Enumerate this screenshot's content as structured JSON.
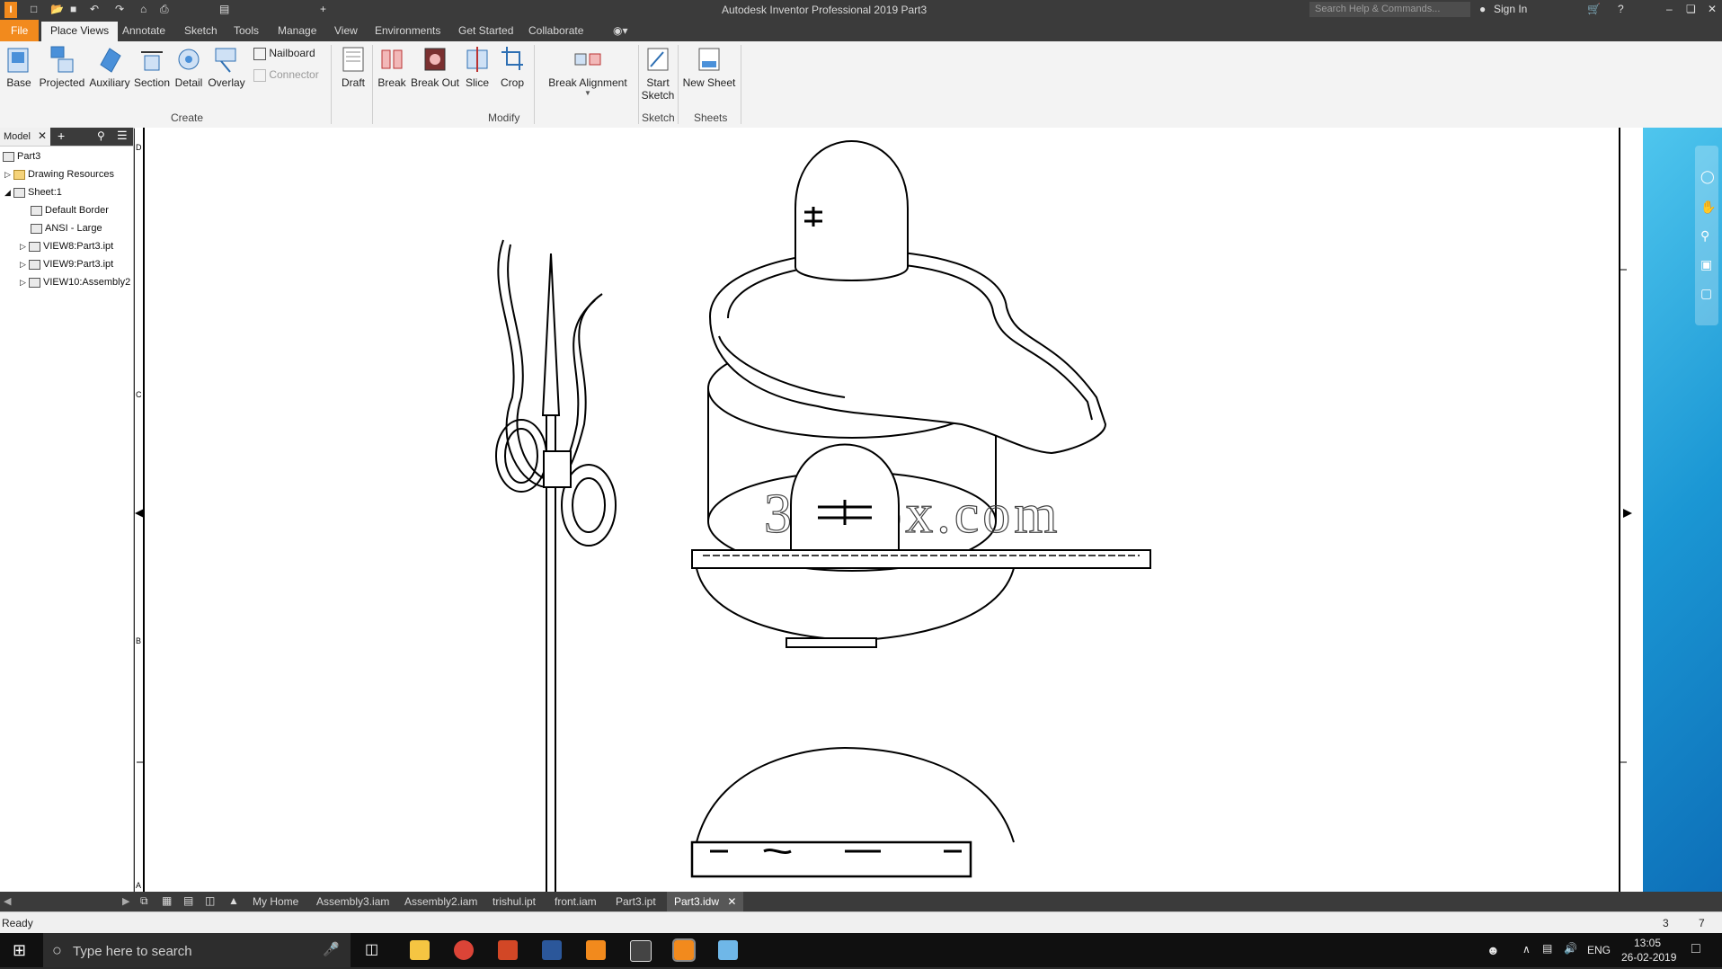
{
  "titlebar": {
    "title": "Autodesk Inventor Professional 2019   Part3",
    "search_placeholder": "Search Help & Commands...",
    "sign_in": "Sign In"
  },
  "ribbon_tabs": [
    "File",
    "Place Views",
    "Annotate",
    "Sketch",
    "Tools",
    "Manage",
    "View",
    "Environments",
    "Get Started",
    "Collaborate"
  ],
  "ribbon": {
    "create": {
      "buttons": [
        "Base",
        "Projected",
        "Auxiliary",
        "Section",
        "Detail",
        "Overlay"
      ],
      "small": [
        "Nailboard",
        "Connector"
      ],
      "label": "Create"
    },
    "modify": {
      "buttons": [
        "Draft",
        "Break",
        "Break Out",
        "Slice",
        "Crop",
        "Break Alignment"
      ],
      "label": "Modify"
    },
    "sketch": {
      "button_line1": "Start",
      "button_line2": "Sketch",
      "label": "Sketch"
    },
    "sheets": {
      "button": "New Sheet",
      "label": "Sheets"
    }
  },
  "browser": {
    "tab": "Model",
    "tree": [
      "Part3",
      "Drawing Resources",
      "Sheet:1",
      "Default Border",
      "ANSI - Large",
      "VIEW8:Part3.ipt",
      "VIEW9:Part3.ipt",
      "VIEW10:Assembly2"
    ]
  },
  "drawing": {
    "watermark": "3dmox.com",
    "border_letters": [
      "D",
      "C",
      "B",
      "A"
    ]
  },
  "doc_tabs": [
    "My Home",
    "Assembly3.iam",
    "Assembly2.iam",
    "trishul.ipt",
    "front.iam",
    "Part3.ipt",
    "Part3.idw"
  ],
  "status": {
    "text": "Ready",
    "num1": "3",
    "num2": "7"
  },
  "taskbar": {
    "search_placeholder": "Type here to search",
    "lang": "ENG",
    "time": "13:05",
    "date": "26-02-2019"
  }
}
